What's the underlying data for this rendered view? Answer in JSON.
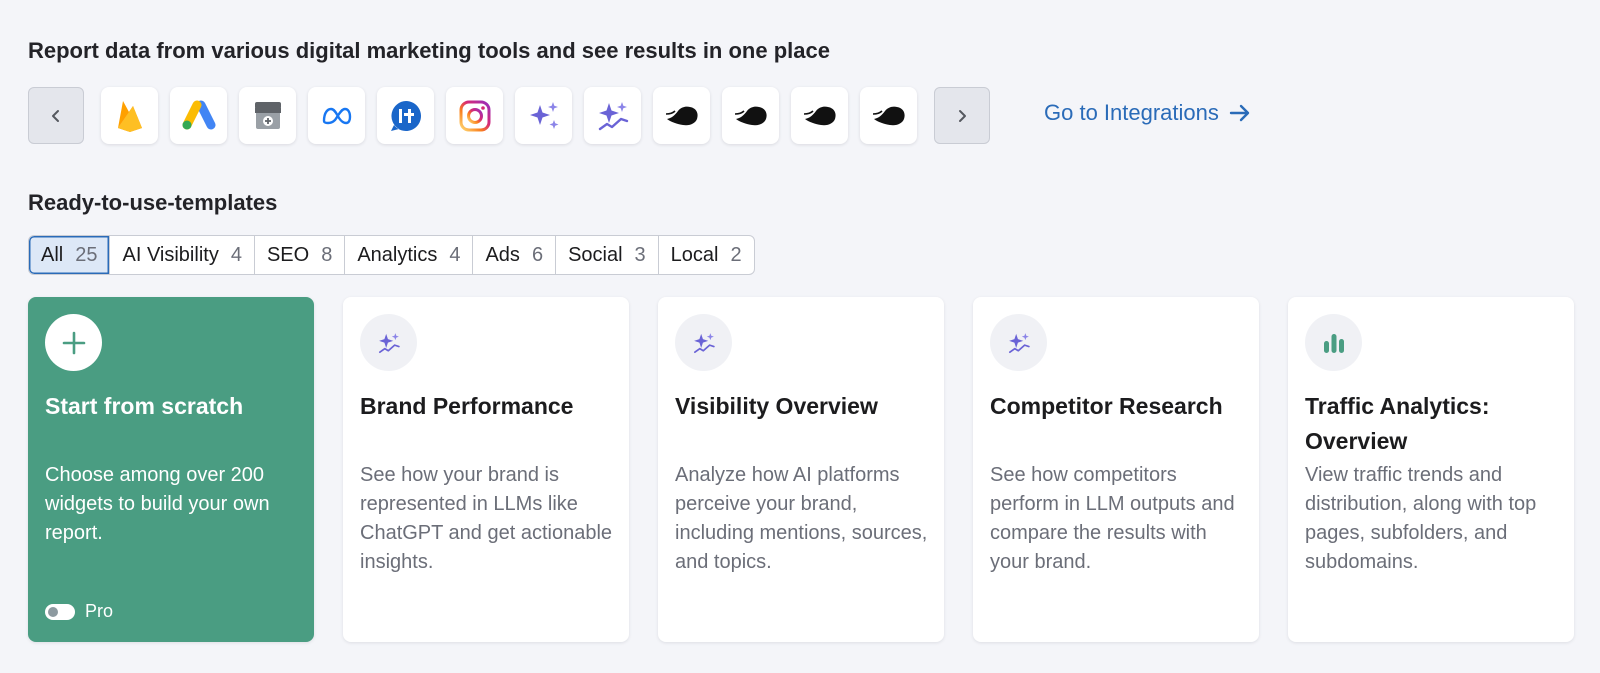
{
  "integrations": {
    "heading": "Report data from various digital marketing tools and see results in one place",
    "prev_icon": "chevron-left-icon",
    "next_icon": "chevron-right-icon",
    "tiles": [
      {
        "icon": "firebase-icon"
      },
      {
        "icon": "google-ads-icon"
      },
      {
        "icon": "google-business-profile-icon"
      },
      {
        "icon": "meta-icon"
      },
      {
        "icon": "callrail-icon"
      },
      {
        "icon": "instagram-icon"
      },
      {
        "icon": "ai-sparkle-icon"
      },
      {
        "icon": "ai-sparkle-trend-icon"
      },
      {
        "icon": "semrush-dark-icon"
      },
      {
        "icon": "semrush-dark-icon"
      },
      {
        "icon": "semrush-dark-icon"
      },
      {
        "icon": "semrush-dark-icon"
      }
    ],
    "link_label": "Go to Integrations",
    "link_icon": "arrow-right-icon"
  },
  "templates": {
    "heading": "Ready-to-use-templates",
    "tabs": [
      {
        "label": "All",
        "count": "25",
        "active": true
      },
      {
        "label": "AI Visibility",
        "count": "4"
      },
      {
        "label": "SEO",
        "count": "8"
      },
      {
        "label": "Analytics",
        "count": "4"
      },
      {
        "label": "Ads",
        "count": "6"
      },
      {
        "label": "Social",
        "count": "3"
      },
      {
        "label": "Local",
        "count": "2"
      }
    ],
    "cards": [
      {
        "icon": "plus-icon",
        "title": "Start from scratch",
        "description": "Choose among over 200 widgets to build your own report.",
        "toggle_label": "Pro"
      },
      {
        "icon": "ai-sparkle-icon",
        "title": "Brand Performance",
        "description": "See how your brand is represented in LLMs like ChatGPT and get actionable insights."
      },
      {
        "icon": "ai-sparkle-icon",
        "title": "Visibility Overview",
        "description": "Analyze how AI platforms perceive your brand, including mentions, sources, and topics."
      },
      {
        "icon": "ai-sparkle-icon",
        "title": "Competitor Research",
        "description": "See how competitors perform in LLM outputs and compare the results with your brand."
      },
      {
        "icon": "bar-chart-icon",
        "title": "Traffic Analytics: Overview",
        "description": "View traffic trends and distribution, along with top pages, subfolders, and subdomains."
      }
    ]
  },
  "colors": {
    "accent_blue": "#2a6bb8",
    "scratch_green": "#4a9d82",
    "page_bg": "#f4f5f9",
    "sparkle_purple": "#6a63d6"
  }
}
